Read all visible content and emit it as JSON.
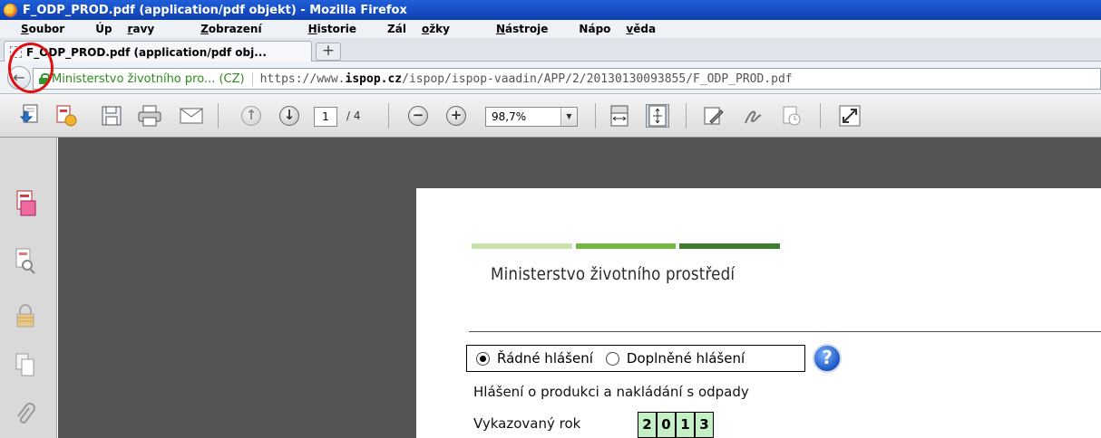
{
  "window": {
    "title": "F_ODP_PROD.pdf (application/pdf objekt) - Mozilla Firefox"
  },
  "menu": [
    {
      "pre": "",
      "key": "S",
      "post": "oubor"
    },
    {
      "pre": "Úp",
      "key": "r",
      "post": "avy"
    },
    {
      "pre": "",
      "key": "Z",
      "post": "obrazení"
    },
    {
      "pre": "",
      "key": "H",
      "post": "istorie"
    },
    {
      "pre": "Zál",
      "key": "o",
      "post": "žky"
    },
    {
      "pre": "",
      "key": "N",
      "post": "ástroje"
    },
    {
      "pre": "Nápo",
      "key": "v",
      "post": "ěda"
    }
  ],
  "tabs": {
    "active_label": "F_ODP_PROD.pdf (application/pdf obj...",
    "new_tab": "+"
  },
  "navbar": {
    "identity": "Ministerstvo životního pro... (CZ)",
    "url_prefix": "https://www.",
    "url_domain": "ispop.cz",
    "url_path": "/ispop/ispop-vaadin/APP/2/20130130093855/F_ODP_PROD.pdf"
  },
  "pdf_toolbar": {
    "page_current": "1",
    "page_total": "/ 4",
    "zoom": "98,7%"
  },
  "document": {
    "ministry": "Ministerstvo životního prostředí",
    "radio_regular": "Řádné hlášení",
    "radio_supplementary": "Doplněné hlášení",
    "help": "?",
    "form_title": "Hlášení o produkci a nakládání s odpady",
    "year_label": "Vykazovaný rok",
    "year_digits": [
      "2",
      "0",
      "1",
      "3"
    ],
    "colors": {
      "green_light": "#c6e3a8",
      "green_mid": "#72b843",
      "green_dark": "#3f7f2c",
      "digit_bg": "#c5f0c5"
    }
  }
}
